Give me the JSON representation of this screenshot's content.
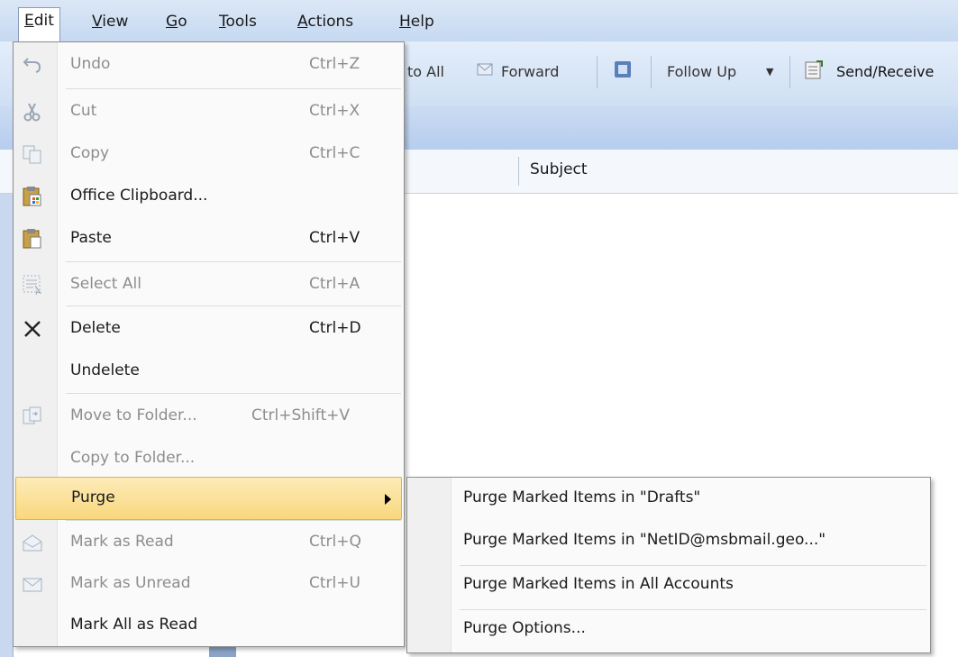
{
  "menubar": {
    "items": [
      {
        "label": "Edit",
        "u": "E"
      },
      {
        "label": "View",
        "u": "V"
      },
      {
        "label": "Go",
        "u": "G"
      },
      {
        "label": "Tools",
        "u": "T"
      },
      {
        "label": "Actions",
        "u": "A"
      },
      {
        "label": "Help",
        "u": "H"
      }
    ]
  },
  "toolbar": {
    "reply_all": "to All",
    "forward": "Forward",
    "follow_up": "Follow Up",
    "send_receive": "Send/Receive"
  },
  "list_header": {
    "subject": "Subject"
  },
  "edit_menu": {
    "undo": "Undo",
    "undo_sc": "Ctrl+Z",
    "cut": "Cut",
    "cut_sc": "Ctrl+X",
    "copy": "Copy",
    "copy_sc": "Ctrl+C",
    "office_clipboard": "Office Clipboard...",
    "paste": "Paste",
    "paste_sc": "Ctrl+V",
    "select_all": "Select All",
    "select_all_sc": "Ctrl+A",
    "delete": "Delete",
    "delete_sc": "Ctrl+D",
    "undelete": "Undelete",
    "move_to_folder": "Move to Folder...",
    "move_to_folder_sc": "Ctrl+Shift+V",
    "copy_to_folder": "Copy to Folder...",
    "purge": "Purge",
    "mark_as_read": "Mark as Read",
    "mark_as_read_sc": "Ctrl+Q",
    "mark_as_unread": "Mark as Unread",
    "mark_as_unread_sc": "Ctrl+U",
    "mark_all_as_read": "Mark All as Read"
  },
  "purge_submenu": {
    "drafts": "Purge Marked Items in \"Drafts\"",
    "netid": "Purge Marked Items in \"NetID@msbmail.geo...\"",
    "all_accounts": "Purge Marked Items in All Accounts",
    "options": "Purge Options..."
  }
}
